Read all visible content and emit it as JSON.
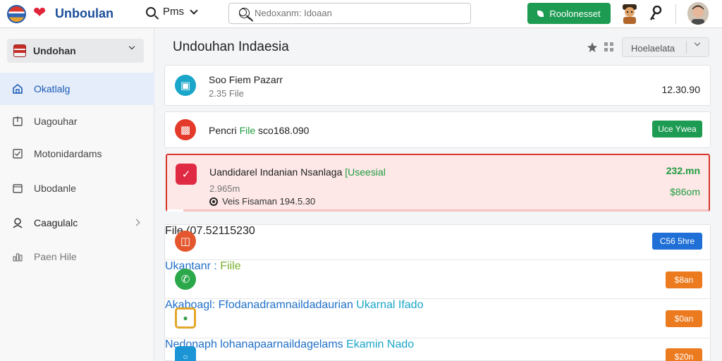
{
  "app": {
    "brand": "Unboulan",
    "search_toggle_label": "Pms",
    "search_placeholder": "Nedoxanm: Idoaan",
    "cta_label": "Roolonesset"
  },
  "sidebar": {
    "workspace": "Undohan",
    "items": [
      {
        "label": "Okatlalg",
        "icon": "home-icon",
        "active": true
      },
      {
        "label": "Uagouhar",
        "icon": "download-icon",
        "active": false
      },
      {
        "label": "Motonidardams",
        "icon": "checkbox-icon",
        "active": false
      },
      {
        "label": "Ubodanle",
        "icon": "calendar-icon",
        "active": false
      },
      {
        "label": "Caagulalc",
        "icon": "user-icon",
        "active": false,
        "has_arrow": true
      },
      {
        "label": "Paen Hile",
        "icon": "chart-icon",
        "active": false
      }
    ]
  },
  "main": {
    "title": "Undouhan Indaesia",
    "sort_label": "Hoelaelata",
    "rows": [
      {
        "title": "Soo Fiem Pazarr",
        "sub": "2.35 File",
        "right": "12.30.90",
        "icon": "gift-icon",
        "color": "#1aa6c9"
      },
      {
        "title_pre": "Pencri ",
        "title_hl": "File",
        "title_post": " sco168.090",
        "button": "Uce Ywea",
        "icon": "calendar-icon",
        "color": "#e43a2a",
        "button_color": "#1e9b53"
      },
      {
        "title_pre": "Uandidarel ",
        "title_mid": "Indanian Nsanlaga ",
        "title_hl": "[Useesial",
        "sub": "2.965m",
        "meta": "Veis Fisaman 194.5.30",
        "amount_top": "232.mn",
        "amount_bottom": "$86om",
        "progress": 0.03,
        "icon": "check-icon",
        "color": "#e02a44"
      },
      {
        "title": "File  (07.52115230",
        "button": "C56 5hre",
        "icon": "briefcase-icon",
        "color": "#e4572e",
        "button_color": "#1f6fd6"
      },
      {
        "title_pre": "Ukantanr : ",
        "title_hl": "Fiile",
        "button": "$8an",
        "icon": "phone-icon",
        "color": "#2aa84a",
        "button_color": "#ec7a1e"
      },
      {
        "title_pre": "Akaboagl: Ffodanadramnaildadaurian ",
        "title_hl": "Ukarnal Ifado",
        "button": "$0an",
        "icon": "document-icon",
        "color": "#e3a72a",
        "button_color": "#ec7a1e"
      },
      {
        "title_pre": "Nedonaph lohanapaarnaildagelams ",
        "title_hl": "Ekamin Nado",
        "button": "$20n",
        "icon": "lock-icon",
        "color": "#1b95d6",
        "button_color": "#ec7a1e"
      }
    ]
  }
}
